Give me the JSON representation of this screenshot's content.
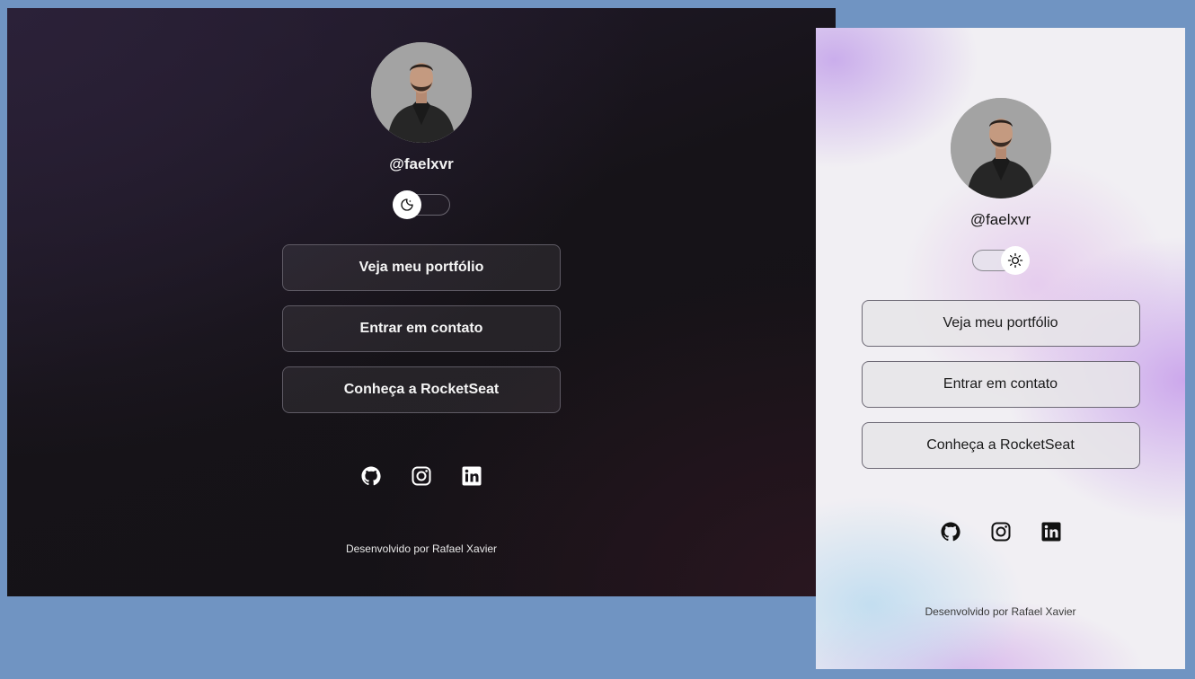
{
  "colors": {
    "page_background": "#7094c2",
    "dark_text": "#f3f3f3",
    "light_text": "#151515"
  },
  "dark_view": {
    "handle": "@faelxvr",
    "theme_toggle": {
      "icon": "moon-icon",
      "state": "dark"
    },
    "links": [
      {
        "label": "Veja meu portfólio"
      },
      {
        "label": "Entrar em contato"
      },
      {
        "label": "Conheça a RocketSeat"
      }
    ],
    "socials": [
      "github-icon",
      "instagram-icon",
      "linkedin-icon"
    ],
    "footer": "Desenvolvido por Rafael Xavier"
  },
  "light_view": {
    "handle": "@faelxvr",
    "theme_toggle": {
      "icon": "sun-icon",
      "state": "light"
    },
    "links": [
      {
        "label": "Veja meu portfólio"
      },
      {
        "label": "Entrar em contato"
      },
      {
        "label": "Conheça a RocketSeat"
      }
    ],
    "socials": [
      "github-icon",
      "instagram-icon",
      "linkedin-icon"
    ],
    "footer": "Desenvolvido por Rafael Xavier"
  }
}
